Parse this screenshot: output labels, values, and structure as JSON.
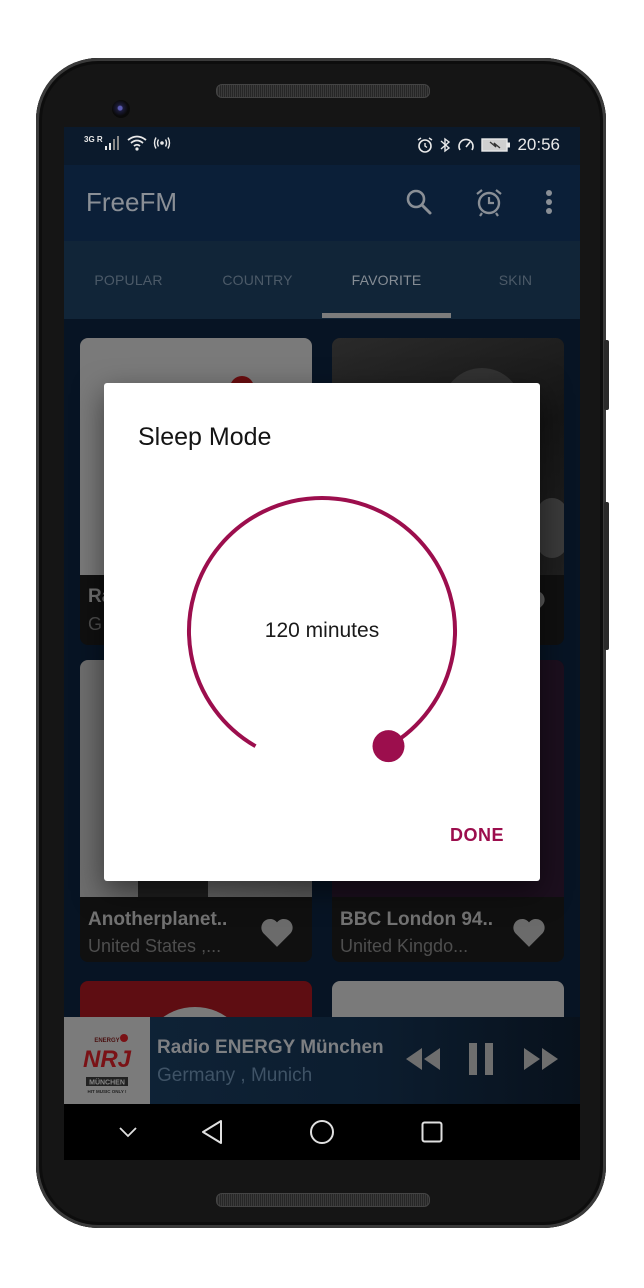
{
  "status_bar": {
    "network_label": "3G R",
    "time": "20:56",
    "icons_left": [
      "signal-icon",
      "wifi-icon",
      "hotspot-icon"
    ],
    "icons_right": [
      "alarm-icon",
      "bluetooth-icon",
      "speed-icon",
      "battery-charging-icon"
    ]
  },
  "app_bar": {
    "title": "FreeFM",
    "actions": [
      "search-icon",
      "alarm-clock-icon",
      "more-vert-icon"
    ]
  },
  "tabs": [
    {
      "label": "POPULAR",
      "active": false
    },
    {
      "label": "COUNTRY",
      "active": false
    },
    {
      "label": "FAVORITE",
      "active": true
    },
    {
      "label": "SKIN",
      "active": false
    }
  ],
  "stations": [
    {
      "name": "Ra",
      "location": "G",
      "favorite": true
    },
    {
      "name": "",
      "location": "",
      "favorite": true
    },
    {
      "name": "Anotherplanet..",
      "location": "United States ,...",
      "favorite": true
    },
    {
      "name": "BBC London 94..",
      "location": "United Kingdo...",
      "favorite": true
    },
    {
      "name": "",
      "location": "",
      "favorite": true
    },
    {
      "name": "",
      "location": "",
      "favorite": true
    }
  ],
  "now_playing": {
    "title": "Radio ENERGY München",
    "subtitle": "Germany , Munich",
    "logo_text": "NRJ",
    "logo_sub": "MÜNCHEN",
    "logo_tagline": "HIT MUSIC ONLY !",
    "controls": [
      "rewind-icon",
      "pause-icon",
      "fast-forward-icon"
    ]
  },
  "nav_bar": [
    "chevron-down-icon",
    "back-icon",
    "home-icon",
    "recents-icon"
  ],
  "dialog": {
    "title": "Sleep Mode",
    "value_label": "120 minutes",
    "value_minutes": 120,
    "fraction": 1.0,
    "done_label": "DONE",
    "accent_color": "#9c0e4d"
  },
  "colors": {
    "app_bar": "#0b1f38",
    "accent": "#9c0e4d"
  }
}
